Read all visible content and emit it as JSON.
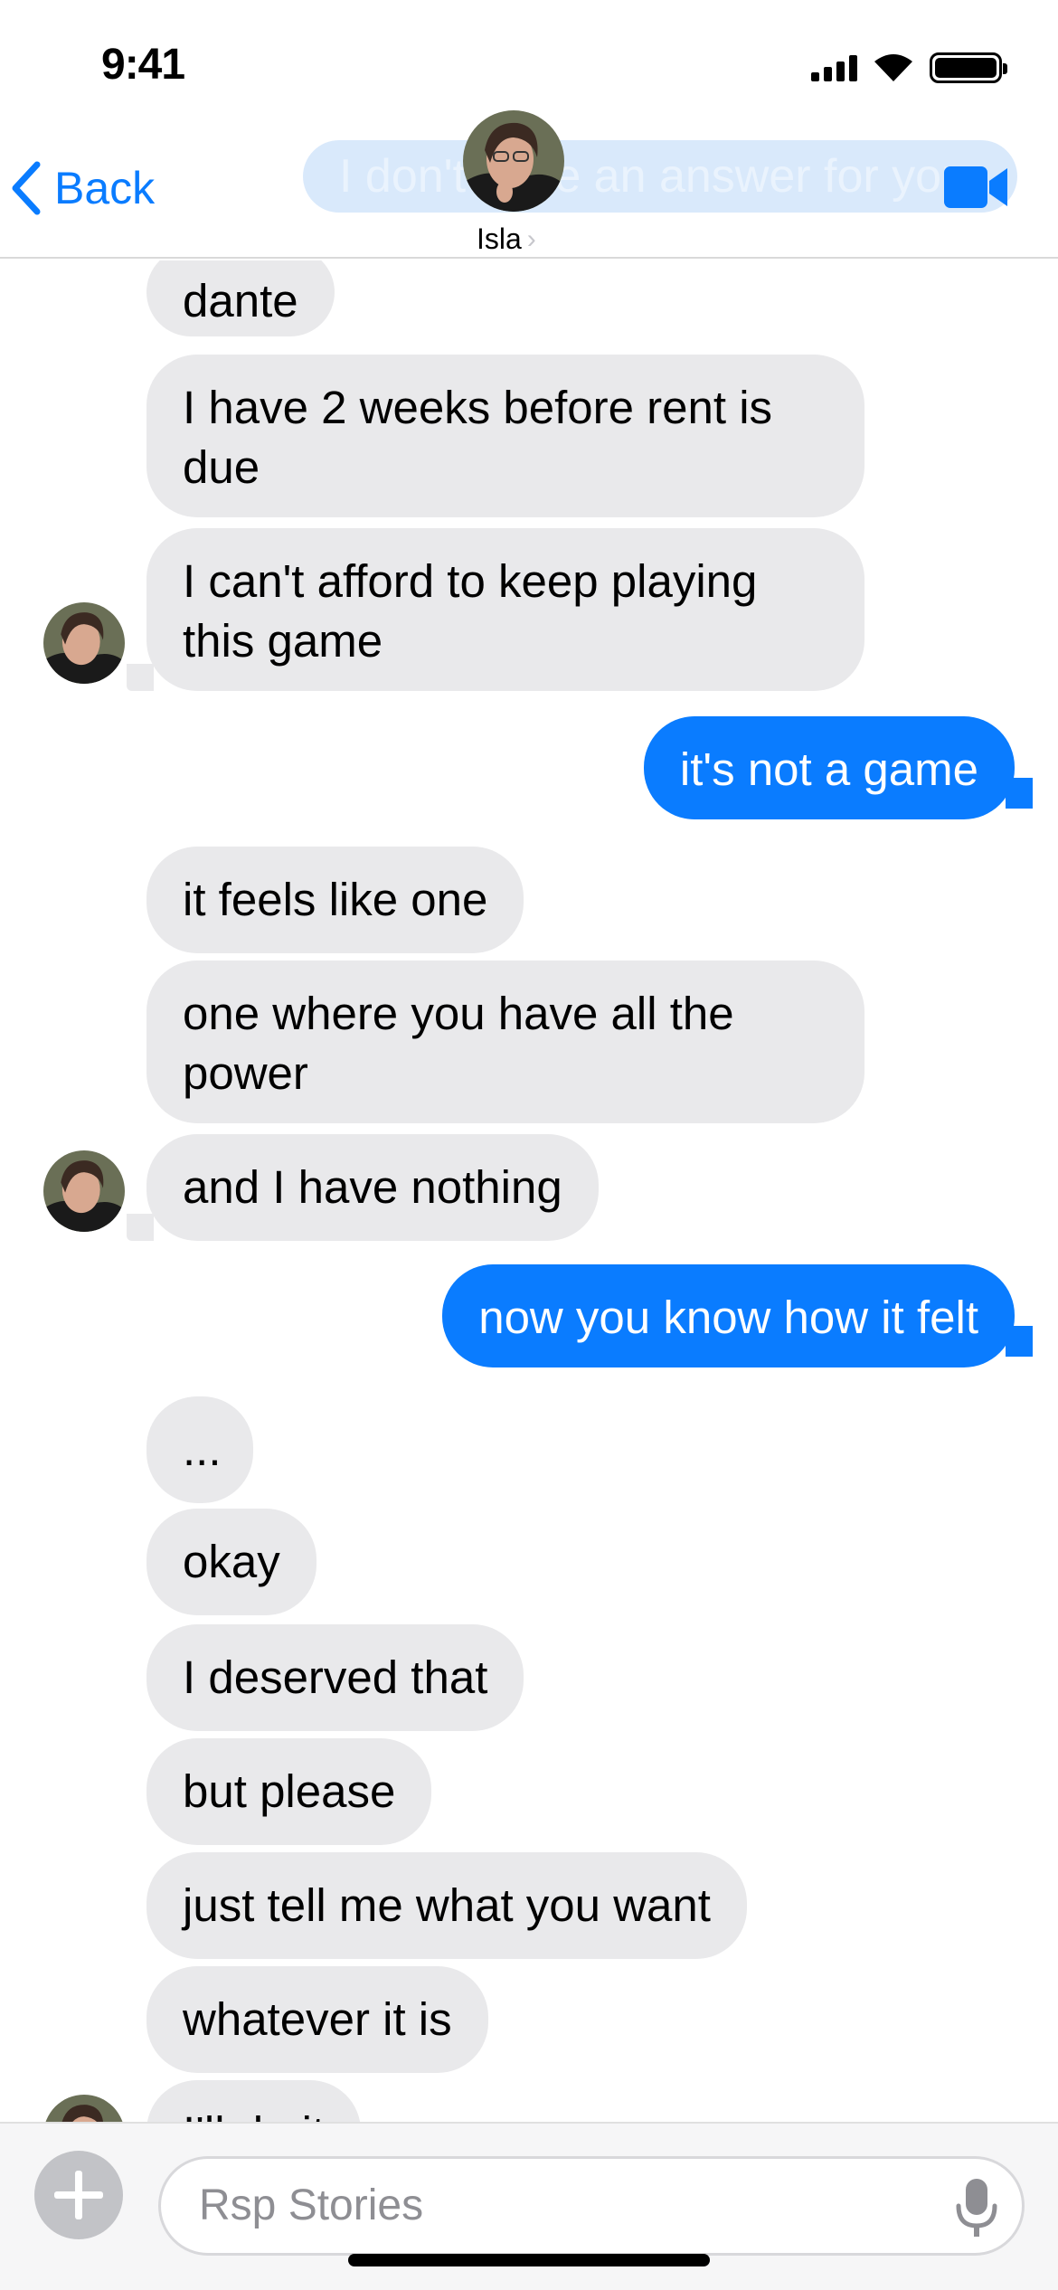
{
  "status_bar": {
    "time": "9:41"
  },
  "header": {
    "back_label": "Back",
    "contact_name": "Isla",
    "ghost_preview": "I don't have an answer for you"
  },
  "messages": [
    {
      "dir": "in",
      "text": "dante"
    },
    {
      "dir": "in",
      "text": "I have 2 weeks before rent is due"
    },
    {
      "dir": "in",
      "text": "I can't afford to keep playing this game"
    },
    {
      "dir": "out",
      "text": "it's not a game"
    },
    {
      "dir": "in",
      "text": "it feels like one"
    },
    {
      "dir": "in",
      "text": "one where you have all the power"
    },
    {
      "dir": "in",
      "text": "and I have nothing"
    },
    {
      "dir": "out",
      "text": "now you know how it felt"
    },
    {
      "dir": "in",
      "text": "..."
    },
    {
      "dir": "in",
      "text": "okay"
    },
    {
      "dir": "in",
      "text": "I deserved that"
    },
    {
      "dir": "in",
      "text": "but please"
    },
    {
      "dir": "in",
      "text": "just tell me what you want"
    },
    {
      "dir": "in",
      "text": "whatever it is"
    },
    {
      "dir": "in",
      "text": "I'll do it"
    }
  ],
  "composer": {
    "placeholder": "Rsp Stories"
  },
  "colors": {
    "accent": "#0a7cff",
    "incoming_bubble": "#e9e9eb"
  }
}
